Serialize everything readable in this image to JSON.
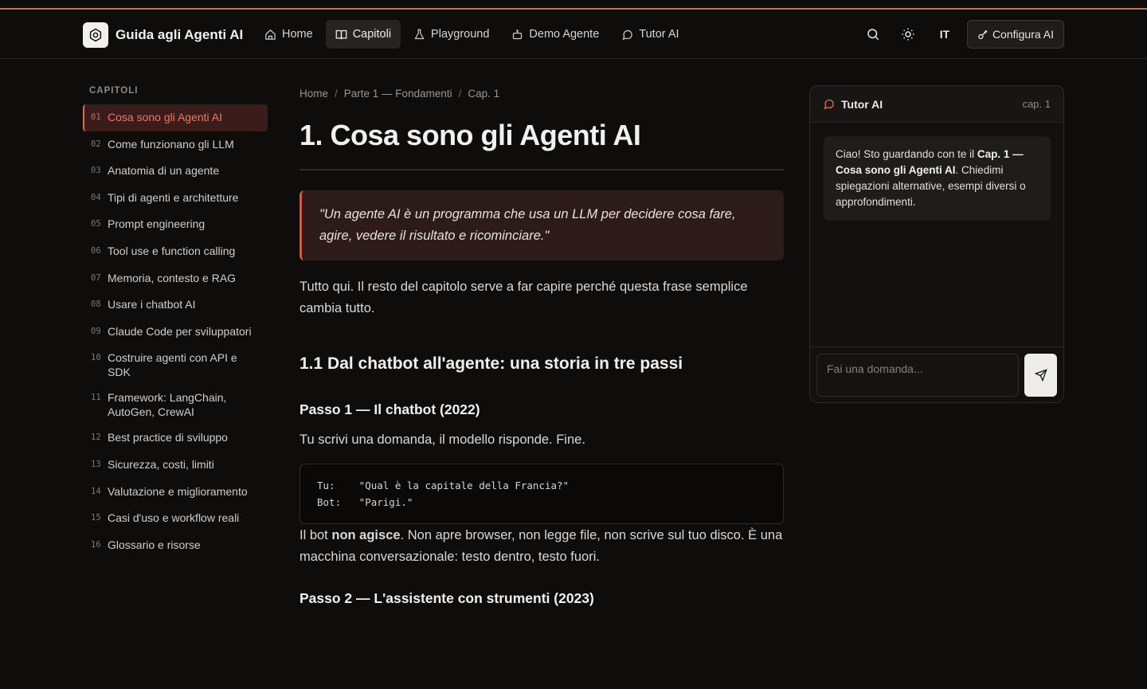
{
  "header": {
    "brand_title": "Guida agli Agenti AI",
    "brand_icon": "gear-icon",
    "nav": [
      {
        "label": "Home",
        "icon": "home-icon"
      },
      {
        "label": "Capitoli",
        "icon": "book-icon",
        "active": true
      },
      {
        "label": "Playground",
        "icon": "flask-icon"
      },
      {
        "label": "Demo Agente",
        "icon": "robot-icon"
      },
      {
        "label": "Tutor AI",
        "icon": "chat-icon"
      }
    ],
    "lang": "IT",
    "config_label": "Configura AI"
  },
  "sidebar": {
    "title": "CAPITOLI",
    "chapters": [
      {
        "num": "01",
        "label": "Cosa sono gli Agenti AI",
        "active": true
      },
      {
        "num": "02",
        "label": "Come funzionano gli LLM"
      },
      {
        "num": "03",
        "label": "Anatomia di un agente"
      },
      {
        "num": "04",
        "label": "Tipi di agenti e architetture"
      },
      {
        "num": "05",
        "label": "Prompt engineering"
      },
      {
        "num": "06",
        "label": "Tool use e function calling"
      },
      {
        "num": "07",
        "label": "Memoria, contesto e RAG"
      },
      {
        "num": "08",
        "label": "Usare i chatbot AI"
      },
      {
        "num": "09",
        "label": "Claude Code per sviluppatori"
      },
      {
        "num": "10",
        "label": "Costruire agenti con API e SDK"
      },
      {
        "num": "11",
        "label": "Framework: LangChain, AutoGen, CrewAI"
      },
      {
        "num": "12",
        "label": "Best practice di sviluppo"
      },
      {
        "num": "13",
        "label": "Sicurezza, costi, limiti"
      },
      {
        "num": "14",
        "label": "Valutazione e miglioramento"
      },
      {
        "num": "15",
        "label": "Casi d'uso e workflow reali"
      },
      {
        "num": "16",
        "label": "Glossario e risorse"
      }
    ]
  },
  "main": {
    "breadcrumb": [
      "Home",
      "Parte 1 — Fondamenti",
      "Cap. 1"
    ],
    "title": "1. Cosa sono gli Agenti AI",
    "quote": "\"Un agente AI è un programma che usa un LLM per decidere cosa fare, agire, vedere il risultato e ricominciare.\"",
    "intro": "Tutto qui. Il resto del capitolo serve a far capire perché questa frase semplice cambia tutto.",
    "section_title": "1.1 Dal chatbot all'agente: una storia in tre passi",
    "step1_title": "Passo 1 — Il chatbot (2022)",
    "step1_text": "Tu scrivi una domanda, il modello risponde. Fine.",
    "code": "Tu:    \"Qual è la capitale della Francia?\"\nBot:   \"Parigi.\"",
    "p3_a": "Il bot ",
    "p3_bold": "non agisce",
    "p3_b": ". Non apre browser, non legge file, non scrive sul tuo disco. È una macchina conversazionale: testo dentro, testo fuori.",
    "step2_title": "Passo 2 — L'assistente con strumenti (2023)"
  },
  "tutor": {
    "title": "Tutor AI",
    "chapter": "cap. 1",
    "msg_a": "Ciao! Sto guardando con te il ",
    "msg_bold": "Cap. 1 — Cosa sono gli Agenti AI",
    "msg_b": ". Chiedimi spiegazioni alternative, esempi diversi o approfondimenti.",
    "placeholder": "Fai una domanda..."
  },
  "colors": {
    "accent": "#e26a55",
    "top_line": "#c07a42",
    "background": "#0e0d0c"
  }
}
